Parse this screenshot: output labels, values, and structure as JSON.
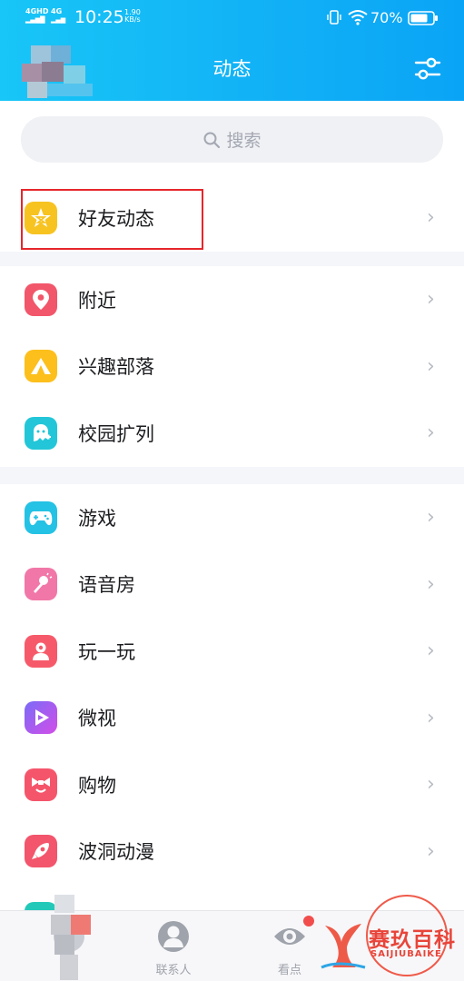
{
  "status_bar": {
    "network1": "4GHD",
    "network1b": "",
    "network2": "4G",
    "time": "10:25",
    "speed_value": "1.90",
    "speed_unit": "KB/s",
    "battery": "70%"
  },
  "header": {
    "title": "动态",
    "settings_icon": "sliders-icon"
  },
  "search": {
    "placeholder": "搜索"
  },
  "sections": [
    {
      "items": [
        {
          "label": "好友动态",
          "icon": "qzone-star-icon",
          "color": "#f7c321"
        }
      ]
    },
    {
      "items": [
        {
          "label": "附近",
          "icon": "location-pin-icon",
          "color": "#f2566a"
        },
        {
          "label": "兴趣部落",
          "icon": "tent-icon",
          "color": "#fcbf1c"
        },
        {
          "label": "校园扩列",
          "icon": "campus-ghost-icon",
          "color": "#23c6d8"
        }
      ]
    },
    {
      "items": [
        {
          "label": "游戏",
          "icon": "gamepad-icon",
          "color": "#24c2e4"
        },
        {
          "label": "语音房",
          "icon": "microphone-icon",
          "color": "#f177a8"
        },
        {
          "label": "玩一玩",
          "icon": "play-avatar-icon",
          "color": "#f65a6a"
        },
        {
          "label": "微视",
          "icon": "weishi-play-icon",
          "color": "#a560ef"
        },
        {
          "label": "购物",
          "icon": "shopping-bow-icon",
          "color": "#f5556b"
        },
        {
          "label": "波洞动漫",
          "icon": "anime-rocket-icon",
          "color": "#f2556c"
        }
      ]
    }
  ],
  "tabbar": {
    "tabs": [
      {
        "label": "",
        "icon": "message-icon"
      },
      {
        "label": "联系人",
        "icon": "contacts-icon"
      },
      {
        "label": "看点",
        "icon": "eye-icon"
      },
      {
        "label": "",
        "icon": "dynamic-icon"
      }
    ]
  },
  "watermark": {
    "brand": "赛玖百科",
    "sub": "SAIJIUBAIKE"
  },
  "colors": {
    "header_start": "#18c6f7",
    "header_end": "#0aa4f6",
    "highlight": "#e6262b",
    "chevron": "#b7bbc3"
  }
}
